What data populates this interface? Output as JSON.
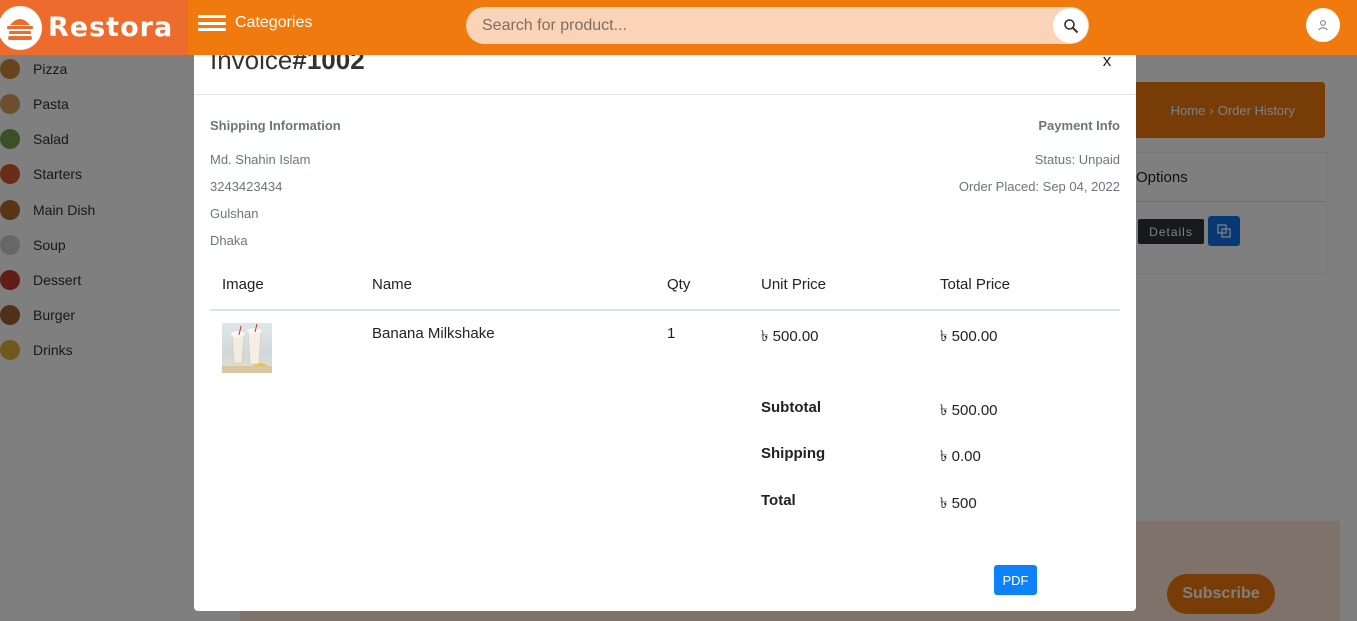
{
  "header": {
    "brand": "Restora",
    "categories_label": "Categories",
    "search_placeholder": "Search for product..."
  },
  "sidebar": {
    "items": [
      {
        "label": "Pizza",
        "color": "#c98a3a"
      },
      {
        "label": "Pasta",
        "color": "#d9a15c"
      },
      {
        "label": "Salad",
        "color": "#7aa04a"
      },
      {
        "label": "Starters",
        "color": "#d25b2e"
      },
      {
        "label": "Main Dish",
        "color": "#b06a2a"
      },
      {
        "label": "Soup",
        "color": "#cfcfcf"
      },
      {
        "label": "Dessert",
        "color": "#c0392b"
      },
      {
        "label": "Burger",
        "color": "#a0612e"
      },
      {
        "label": "Drinks",
        "color": "#e2b33c"
      }
    ]
  },
  "background": {
    "breadcrumb_home": "Home",
    "breadcrumb_current": "Order History",
    "options_header": "Options",
    "details_label": "Details",
    "subscribe_label": "Subscribe"
  },
  "modal": {
    "title_prefix": "Invoice",
    "title_number": "#1002",
    "close_label": "x",
    "shipping_heading": "Shipping Information",
    "shipping_name": "Md. Shahin Islam",
    "shipping_phone": "3243423434",
    "shipping_area": "Gulshan",
    "shipping_city": "Dhaka",
    "payment_heading": "Payment Info",
    "status": "Status: Unpaid",
    "order_placed": "Order Placed: Sep 04, 2022",
    "columns": [
      "Image",
      "Name",
      "Qty",
      "Unit Price",
      "Total Price"
    ],
    "items": [
      {
        "name": "Banana Milkshake",
        "qty": "1",
        "unit_price": "৳ 500.00",
        "total_price": "৳ 500.00"
      }
    ],
    "subtotal_label": "Subtotal",
    "subtotal_value": "৳ 500.00",
    "shipping_label": "Shipping",
    "shipping_value": "৳ 0.00",
    "total_label": "Total",
    "total_value": "৳ 500",
    "pdf_label": "PDF"
  },
  "colors": {
    "brand_orange": "#f07a0e",
    "logo_orange": "#ee6b2e",
    "pdf_blue": "#0d82f8",
    "compare_blue": "#1172ea"
  }
}
